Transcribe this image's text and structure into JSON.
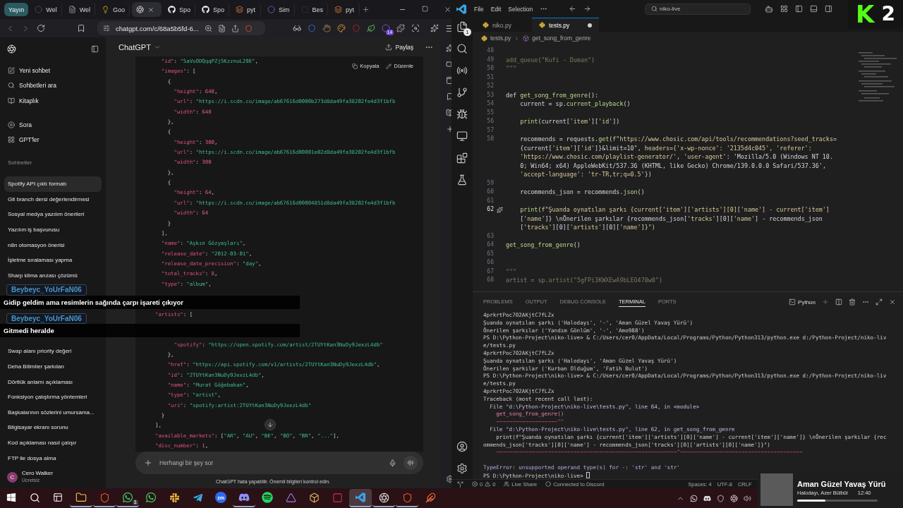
{
  "browser": {
    "tabs": [
      {
        "kind": "pill",
        "label": "Yayın",
        "selected": false
      },
      {
        "kind": "circle",
        "label": "Wel",
        "selected": false
      },
      {
        "kind": "page",
        "label": "Wel",
        "selected": false
      },
      {
        "kind": "bulb",
        "label": "Goo",
        "selected": false
      },
      {
        "kind": "aperture",
        "selected": true
      },
      {
        "kind": "cat",
        "label": "Spo",
        "selected": false
      },
      {
        "kind": "cat",
        "label": "Spo",
        "selected": false
      },
      {
        "kind": "layers",
        "label": "pyt",
        "selected": false
      },
      {
        "kind": "orb",
        "label": "Sim",
        "selected": false
      },
      {
        "kind": "square",
        "label": "Bes",
        "selected": false
      },
      {
        "kind": "layers",
        "label": "pyt",
        "selected": false
      }
    ],
    "url": "chatgpt.com/c/68a5b5fd-6...",
    "extension_badge": "14"
  },
  "chatgpt": {
    "nav": [
      {
        "kind": "new",
        "label": "Yeni sohbet"
      },
      {
        "kind": "search",
        "label": "Sohbetleri ara"
      },
      {
        "kind": "library",
        "label": "Kitaplık"
      }
    ],
    "tools": [
      {
        "kind": "play",
        "label": "Sora"
      },
      {
        "kind": "grid",
        "label": "GPT'ler"
      }
    ],
    "section": "Sohbetler",
    "chats": [
      {
        "label": "Spotify API çıktı formatı",
        "selected": true
      },
      {
        "label": "Git branch dersi değerlendirmesi",
        "selected": false
      },
      {
        "label": "Sosyal medya yazılım önerileri",
        "selected": false
      },
      {
        "label": "Yazılım iş başvurusu",
        "selected": false
      },
      {
        "label": "n8n otomasyon önerisi",
        "selected": false
      },
      {
        "label": "İşletme sıralaması yapma",
        "selected": false
      },
      {
        "label": "Sharp klima arızası çözümü",
        "selected": false
      }
    ],
    "chats_more": [
      {
        "label": "Swap alanı priority değeri",
        "selected": false
      },
      {
        "label": "Deha Bilimlier şarkıları",
        "selected": false
      },
      {
        "label": "Dörtlük anlamı açıklaması",
        "selected": false
      },
      {
        "label": "Fonksiyon çalıştırma yöntemleri",
        "selected": false
      },
      {
        "label": "Başkalarının sözlerini umursama...",
        "selected": false
      },
      {
        "label": "Bilgisayar ekranı sorunu",
        "selected": false
      },
      {
        "label": "Kod açıklaması nasıl çalışır",
        "selected": false
      },
      {
        "label": "FTP ile dosya alma",
        "selected": false
      }
    ],
    "user": {
      "initial": "C",
      "name": "Cero Walker",
      "plan": "Ücretsiz"
    },
    "title": "ChatGPT",
    "share": "Paylaş",
    "code_actions": [
      "Kopyala",
      "Düzenle"
    ],
    "code_groups": [
      [
        "  \"id\": \"5aVoODQqqPZj5KzznuL20E\",",
        "  \"images\": [",
        "    {",
        "      \"height\": 640,",
        "      \"url\": \"https://i.scdn.co/image/ab67616d0000b273d8da49fa38202fe4d3f1bfb",
        "      \"width\": 640",
        "    },",
        "    {",
        "      \"height\": 300,",
        "      \"url\": \"https://i.scdn.co/image/ab67616d00001e02d8da49fa38202fe4d3f1bfb",
        "      \"width\": 300",
        "    },",
        "    {",
        "      \"height\": 64,",
        "      \"url\": \"https://i.scdn.co/image/ab67616d00004851d8da49fa38202fe4d3f1bfb",
        "      \"width\": 64",
        "    }",
        "  ],",
        "  \"name\": \"Aşkın Gözyaşları\",",
        "  \"release_date\": \"2012-03-01\",",
        "  \"release_date_precision\": \"day\",",
        "  \"total_tracks\": 8,",
        "  \"type\": \"album\","
      ],
      [
        "\"artists\": ["
      ],
      [
        "      \"spotify\": \"https://open.spotify.com/artist/2TUYtKan3NuDy9JexzL4db\"",
        "    },",
        "    \"href\": \"https://api.spotify.com/v1/artists/2TUYtKan3NuDy9JexzL4db\",",
        "    \"id\": \"2TUYtKan3NuDy9JexzL4db\",",
        "    \"name\": \"Murat Göğebakan\",",
        "    \"type\": \"artist\",",
        "    \"uri\": \"spotify:artist:2TUYtKan3NuDy9JexzL4db\"",
        "  }",
        "],",
        "\"available_markets\": [\"AR\", \"AU\", \"BE\", \"BO\", \"BR\", \"...\"],",
        "\"disc_number\": 1,"
      ]
    ],
    "input_placeholder": "Herhangi bir şey sor",
    "disclaimer": "ChatGPT hata yapabilir. Önemli bilgileri kontrol edin."
  },
  "stream_chat": [
    {
      "user": "Beybeyc_YoUrFaN06",
      "message": "Gidip geldim ama resimlerin sağında çarpı işareti çıkıyor"
    },
    {
      "user": "Beybeyc_YoUrFaN06",
      "message": "Gitmedi heralde"
    }
  ],
  "stream_logo": {
    "letter": "K",
    "number": "2"
  },
  "vscode": {
    "menu": [
      "File",
      "Edit",
      "Selection"
    ],
    "search": "niko-live",
    "explorer_badge": "1",
    "tabs": [
      {
        "label": "niko.py",
        "selected": false,
        "modified": false
      },
      {
        "label": "tests.py",
        "selected": true,
        "modified": true
      }
    ],
    "breadcrumb": [
      "tests.py",
      "get_song_from_genre"
    ],
    "lines": [
      {
        "number": "48",
        "current": false
      },
      {
        "number": "49",
        "rows": [
          "add_queue(\"Kufi - Duman\")"
        ],
        "dimmed": true,
        "current": false
      },
      {
        "number": "50",
        "rows": [
          "\"\"\""
        ],
        "dimmed": true,
        "current": false
      },
      {
        "number": "51",
        "current": false
      },
      {
        "number": "52",
        "current": false
      },
      {
        "number": "53",
        "rows": [
          "def get_song_from_genre():"
        ],
        "dimmed": false,
        "current": false
      },
      {
        "number": "54",
        "rows": [
          "    current = sp.current_playback()"
        ],
        "dimmed": false,
        "current": false
      },
      {
        "number": "55",
        "current": false
      },
      {
        "number": "56",
        "rows": [
          "    print(current['item']['id'])"
        ],
        "dimmed": false,
        "current": false
      },
      {
        "number": "57",
        "current": false
      },
      {
        "number": "58",
        "rows": [
          "    recommends = requests.get(f\"https://www.chosic.com/api/tools/recommendations?seed_tracks=",
          "    {current['item']['id']}&limit=10\", headers={'x-wp-nonce': '2135d4c045', 'referer':",
          "    'https://www.chosic.com/playlist-generator/', 'user-agent': 'Mozilla/5.0 (Windows NT 10.",
          "    0; Win64; x64) AppleWebKit/537.36 (KHTML, like Gecko) Chrome/139.0.0.0 Safari/537.36',",
          "    'accept-language': 'tr-TR,tr;q=0.5'})"
        ],
        "dimmed": false,
        "current": false
      },
      {
        "number": "59",
        "current": false
      },
      {
        "number": "60",
        "rows": [
          "    recommends_json = recommends.json()"
        ],
        "dimmed": false,
        "current": false
      },
      {
        "number": "61",
        "current": false
      },
      {
        "number": "62",
        "rows": [
          "    print(f\"Şuanda oynatılan şarkı {current['item']['artists'][0]['name'] - current['item']",
          "    ['name']} \\nÖnerilen şarkılar {recommends_json['tracks'][0]['name'] - recommends_json",
          "    ['tracks'][0]['artists'][0]['name']}\")"
        ],
        "dimmed": false,
        "current": true
      },
      {
        "number": "63",
        "current": false
      },
      {
        "number": "64",
        "rows": [
          "get_song_from_genre()"
        ],
        "dimmed": false,
        "current": false
      },
      {
        "number": "65",
        "current": false
      },
      {
        "number": "66",
        "current": false
      },
      {
        "number": "67",
        "rows": [
          "\"\"\""
        ],
        "dimmed": true,
        "current": false
      },
      {
        "number": "68",
        "rows": [
          "artist = sp.artist(\"5gFPi3KWXEwA9bLEO470w0\")"
        ],
        "dimmed": true,
        "current": false
      }
    ],
    "panel_tabs": [
      {
        "label": "PROBLEMS",
        "selected": false
      },
      {
        "label": "OUTPUT",
        "selected": false
      },
      {
        "label": "DEBUG CONSOLE",
        "selected": false
      },
      {
        "label": "TERMINAL",
        "selected": true
      },
      {
        "label": "PORTS",
        "selected": false
      }
    ],
    "terminal_profile": "Python",
    "terminal_lines": [
      {
        "kind": "output",
        "text": "4prkrtPoc702AKjtC7fLZx"
      },
      {
        "kind": "output",
        "text": "Şuanda oynatılan şarkı ('Halodayı', '-', 'Aman Güzel Yavaş Yürü')"
      },
      {
        "kind": "output",
        "text": "Önerilen şarkılar ('Yandım Gönlüm', '-', 'Amo988')"
      },
      {
        "kind": "command",
        "text": "PS D:\\Python-Project\\niko-live> & C:/Users/cer0/AppData/Local/Programs/Python/Python313/python.exe d:/Python-Project/niko-liv"
      },
      {
        "kind": "output",
        "text": "e/tests.py"
      },
      {
        "kind": "output",
        "text": "4prkrtPoc702AKjtC7fLZx"
      },
      {
        "kind": "output",
        "text": "Şuanda oynatılan şarkı ('Halodayı', 'Aman Güzel Yavaş Yürü')"
      },
      {
        "kind": "output",
        "text": "Önerilen şarkılar ('Kurban Olduğum', 'Fatih Bulut')"
      },
      {
        "kind": "command",
        "text": "PS D:\\Python-Project\\niko-live> & C:/Users/cer0/AppData/Local/Programs/Python/Python313/python.exe d:/Python-Project/niko-liv"
      },
      {
        "kind": "output",
        "text": "e/tests.py"
      },
      {
        "kind": "output",
        "text": "4prkrtPoc702AKjtC7fLZx"
      },
      {
        "kind": "output",
        "text": "Traceback (most recent call last):"
      },
      {
        "kind": "trace",
        "text": "  File \"d:\\Python-Project\\niko-live\\tests.py\", line 64, in <module>"
      },
      {
        "kind": "code",
        "text": "    get_song_from_genre()"
      },
      {
        "kind": "marker",
        "text": "    ~~~~~~~~~~~~~~~~~~~^^"
      },
      {
        "kind": "trace",
        "text": "  File \"d:\\Python-Project\\niko-live\\tests.py\", line 62, in get_song_from_genre"
      },
      {
        "kind": "output",
        "text": "    print(f\"Şuanda oynatılan şarkı {current['item']['artists'][0]['name'] - current['item']['name']} \\nÖnerilen şarkılar {rec"
      },
      {
        "kind": "output",
        "text": "ommends_json['tracks'][0]['name'] - recommends_json['tracks'][0]['artists'][0]['name']}\")"
      },
      {
        "kind": "marker",
        "text": "    ~~~~~~~~~~~~~~~~~~~~~~~~~~~~~~~~~~~~~~~~~~~~~~~~~~~~~~~~^~~~~~~~~~~~~~~~~~~~~~~~~~~~~~~~~~~~~~~"
      },
      {
        "kind": "blank"
      },
      {
        "kind": "error",
        "text": "TypeError: unsupported operand type(s) for -: 'str' and 'str'"
      },
      {
        "kind": "prompt",
        "text": "PS D:\\Python-Project\\niko-live> "
      }
    ],
    "status": {
      "errors": "0",
      "warnings": "0",
      "live_share": "Live Share",
      "discord": "Connected to Discord",
      "items": [
        "Spaces: 4",
        "UTF-8",
        "CRLF"
      ]
    }
  },
  "now_playing": {
    "title": "Aman Güzel Yavaş Yürü",
    "artist": "Halodayı, Azer Bülbül",
    "time": "12:40",
    "level": 0.35
  },
  "taskbar": [
    {
      "kind": "windows",
      "selected": false,
      "running": false
    },
    {
      "kind": "search",
      "selected": false,
      "running": false
    },
    {
      "kind": "taskview",
      "selected": false,
      "running": false
    },
    {
      "kind": "folder",
      "selected": false,
      "running": true
    },
    {
      "kind": "shield",
      "selected": false,
      "running": true
    },
    {
      "kind": "phone",
      "selected": false,
      "running": true,
      "badge": "1"
    },
    {
      "kind": "phone",
      "selected": false,
      "running": false
    },
    {
      "kind": "hash",
      "selected": false,
      "running": false
    },
    {
      "kind": "plane",
      "selected": false,
      "running": false
    },
    {
      "kind": "text",
      "selected": false,
      "running": false,
      "text": "zm"
    },
    {
      "kind": "controller",
      "selected": false,
      "running": true
    },
    {
      "kind": "waves",
      "selected": false,
      "running": false
    },
    {
      "kind": "triangle",
      "selected": false,
      "running": false
    },
    {
      "kind": "box",
      "selected": false,
      "running": false
    },
    {
      "kind": "tile",
      "selected": false,
      "running": false
    },
    {
      "kind": "ribbon",
      "selected": true,
      "running": true
    },
    {
      "kind": "aperture",
      "selected": false,
      "running": true
    },
    {
      "kind": "shield",
      "selected": false,
      "running": true
    },
    {
      "kind": "feather",
      "selected": false,
      "running": false
    }
  ]
}
